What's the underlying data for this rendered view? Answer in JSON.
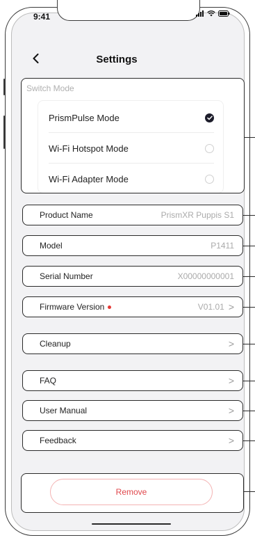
{
  "status_bar": {
    "time": "9:41",
    "icons": [
      "signal-icon",
      "wifi-icon",
      "battery-icon"
    ]
  },
  "header": {
    "title": "Settings",
    "back_icon": "chevron-left-icon"
  },
  "switch_mode": {
    "title": "Switch Mode",
    "options": [
      {
        "label": "PrismPulse Mode",
        "selected": true
      },
      {
        "label": "Wi-Fi Hotspot Mode",
        "selected": false
      },
      {
        "label": "Wi-Fi Adapter Mode",
        "selected": false
      }
    ]
  },
  "info_rows": [
    {
      "label": "Product Name",
      "value": "PrismXR Puppis S1"
    },
    {
      "label": "Model",
      "value": "P1411"
    },
    {
      "label": "Serial Number",
      "value": "X00000000001"
    }
  ],
  "firmware": {
    "label": "Firmware Version",
    "value": "V01.01",
    "has_update_dot": true
  },
  "nav_rows": [
    {
      "label": "Cleanup"
    },
    {
      "label": "FAQ"
    },
    {
      "label": "User Manual"
    },
    {
      "label": "Feedback"
    }
  ],
  "chevron": ">",
  "remove": {
    "label": "Remove"
  },
  "colors": {
    "accent_red": "#e0474c",
    "selected_radio": "#1c1c2a",
    "background": "#f2f2f4"
  }
}
